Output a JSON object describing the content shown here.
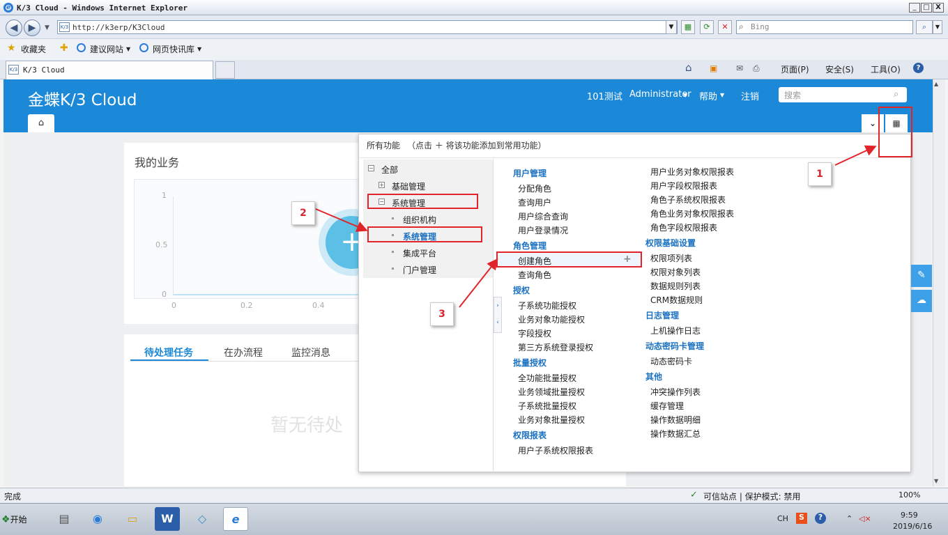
{
  "window": {
    "title": "K/3 Cloud - Windows Internet Explorer",
    "min": "_",
    "max": "□",
    "close": "X"
  },
  "ie": {
    "url": "http://k3erp/K3Cloud",
    "search_placeholder": "Bing",
    "favorites": "收藏夹",
    "suggested_sites": "建议网站",
    "web_slices": "网页快讯库",
    "tab_title": "K/3 Cloud",
    "menu_page": "页面(P)",
    "menu_safety": "安全(S)",
    "menu_tools": "工具(O)"
  },
  "app": {
    "logo": "金蝶K/3 Cloud",
    "org": "101测试",
    "user": "Administrator",
    "help": "帮助",
    "logout": "注销",
    "search_placeholder": "搜索"
  },
  "dashboard": {
    "my_business": "我的业务",
    "y_ticks": [
      "1",
      "0.5",
      "0"
    ],
    "x_ticks": [
      "0",
      "0.2",
      "0.4"
    ],
    "tabs": [
      "待处理任务",
      "在办流程",
      "监控消息"
    ],
    "empty": "暂无待处"
  },
  "panel": {
    "title": "所有功能",
    "hint": "（点击 ＋ 将该功能添加到常用功能）",
    "tree": [
      "全部",
      "基础管理",
      "系统管理",
      "组织机构",
      "系统管理",
      "集成平台",
      "门户管理"
    ],
    "col1": [
      {
        "cat": "用户管理",
        "items": [
          "分配角色",
          "查询用户",
          "用户综合查询",
          "用户登录情况"
        ]
      },
      {
        "cat": "角色管理",
        "items": [
          "创建角色",
          "查询角色"
        ]
      },
      {
        "cat": "授权",
        "items": [
          "子系统功能授权",
          "业务对象功能授权",
          "字段授权",
          "第三方系统登录授权"
        ]
      },
      {
        "cat": "批量授权",
        "items": [
          "全功能批量授权",
          "业务领域批量授权",
          "子系统批量授权",
          "业务对象批量授权"
        ]
      },
      {
        "cat": "权限报表",
        "items": [
          "用户子系统权限报表"
        ]
      }
    ],
    "col2": [
      {
        "cat": "",
        "items": [
          "用户业务对象权限报表",
          "用户字段权限报表",
          "角色子系统权限报表",
          "角色业务对象权限报表",
          "角色字段权限报表"
        ]
      },
      {
        "cat": "权限基础设置",
        "items": [
          "权限项列表",
          "权限对象列表",
          "数据规则列表",
          "CRM数据规则"
        ]
      },
      {
        "cat": "日志管理",
        "items": [
          "上机操作日志"
        ]
      },
      {
        "cat": "动态密码卡管理",
        "items": [
          "动态密码卡"
        ]
      },
      {
        "cat": "其他",
        "items": [
          "冲突操作列表",
          "缓存管理",
          "操作数据明细",
          "操作数据汇总"
        ]
      }
    ]
  },
  "callouts": [
    "1",
    "2",
    "3"
  ],
  "statusbar": {
    "left": "完成",
    "zone": "可信站点 | 保护模式: 禁用",
    "zoom": "100%"
  },
  "taskbar": {
    "start": "开始",
    "lang": "CH",
    "time": "9:59",
    "date": "2019/6/16"
  },
  "colors": {
    "brand": "#1b88d8",
    "category": "#1b72c2",
    "annotation": "#e0242a"
  }
}
